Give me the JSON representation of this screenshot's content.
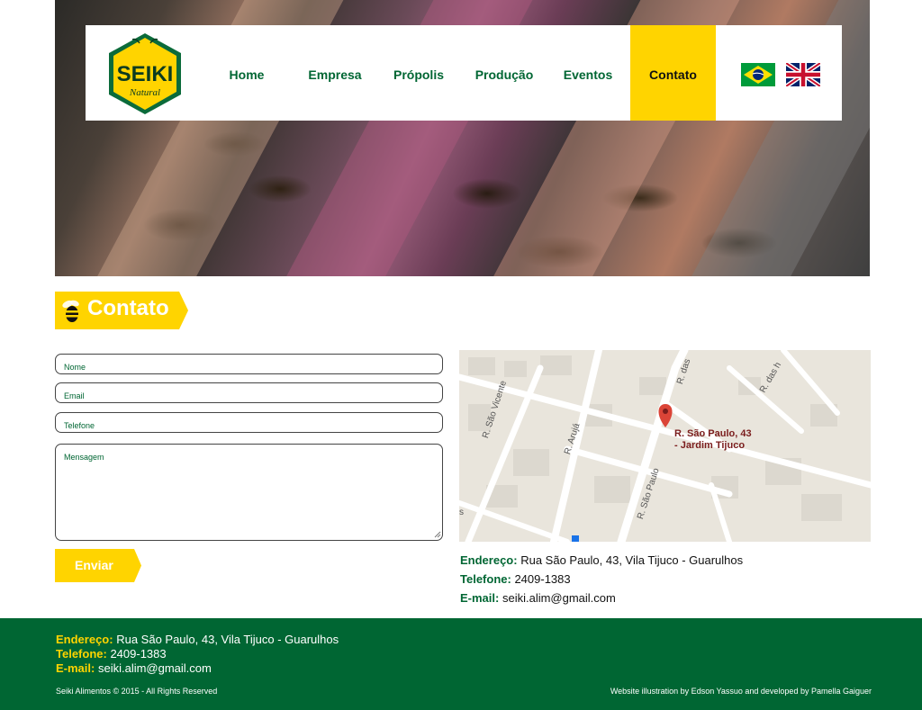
{
  "brand": {
    "logo_text": "SEIKI",
    "logo_sub": "Natural"
  },
  "nav": {
    "items": [
      {
        "label": "Home"
      },
      {
        "label": "Empresa"
      },
      {
        "label": "Própolis"
      },
      {
        "label": "Produção"
      },
      {
        "label": "Eventos"
      },
      {
        "label": "Contato"
      }
    ],
    "active": "Contato",
    "flags": [
      "brazil-flag-icon",
      "uk-flag-icon"
    ]
  },
  "page": {
    "title": "Contato"
  },
  "form": {
    "name_placeholder": "Nome",
    "email_placeholder": "Email",
    "phone_placeholder": "Telefone",
    "message_placeholder": "Mensagem",
    "submit_label": "Enviar"
  },
  "map": {
    "pin_label_1": "R. São Paulo, 43",
    "pin_label_2": "- Jardim Tijuco",
    "streets": [
      "R. São Vicente",
      "R. Arujá",
      "R. São Paulo",
      "R. das",
      "R. das h",
      "s"
    ]
  },
  "contact": {
    "address_label": "Endereço:",
    "address_value": "Rua São Paulo, 43, Vila Tijuco - Guarulhos",
    "phone_label": "Telefone:",
    "phone_value": "2409-1383",
    "email_label": "E-mail:",
    "email_value": "seiki.alim@gmail.com"
  },
  "footer": {
    "address_label": "Endereço:",
    "address_value": "Rua São Paulo, 43, Vila Tijuco - Guarulhos",
    "phone_label": "Telefone:",
    "phone_value": "2409-1383",
    "email_label": "E-mail:",
    "email_value": "seiki.alim@gmail.com",
    "copyright": "Seiki Alimentos © 2015 - All Rights Reserved",
    "credits": "Website illustration by Edson Yassuo and developed by Pamella Gaiguer"
  },
  "colors": {
    "green": "#006633",
    "yellow": "#ffd400"
  }
}
